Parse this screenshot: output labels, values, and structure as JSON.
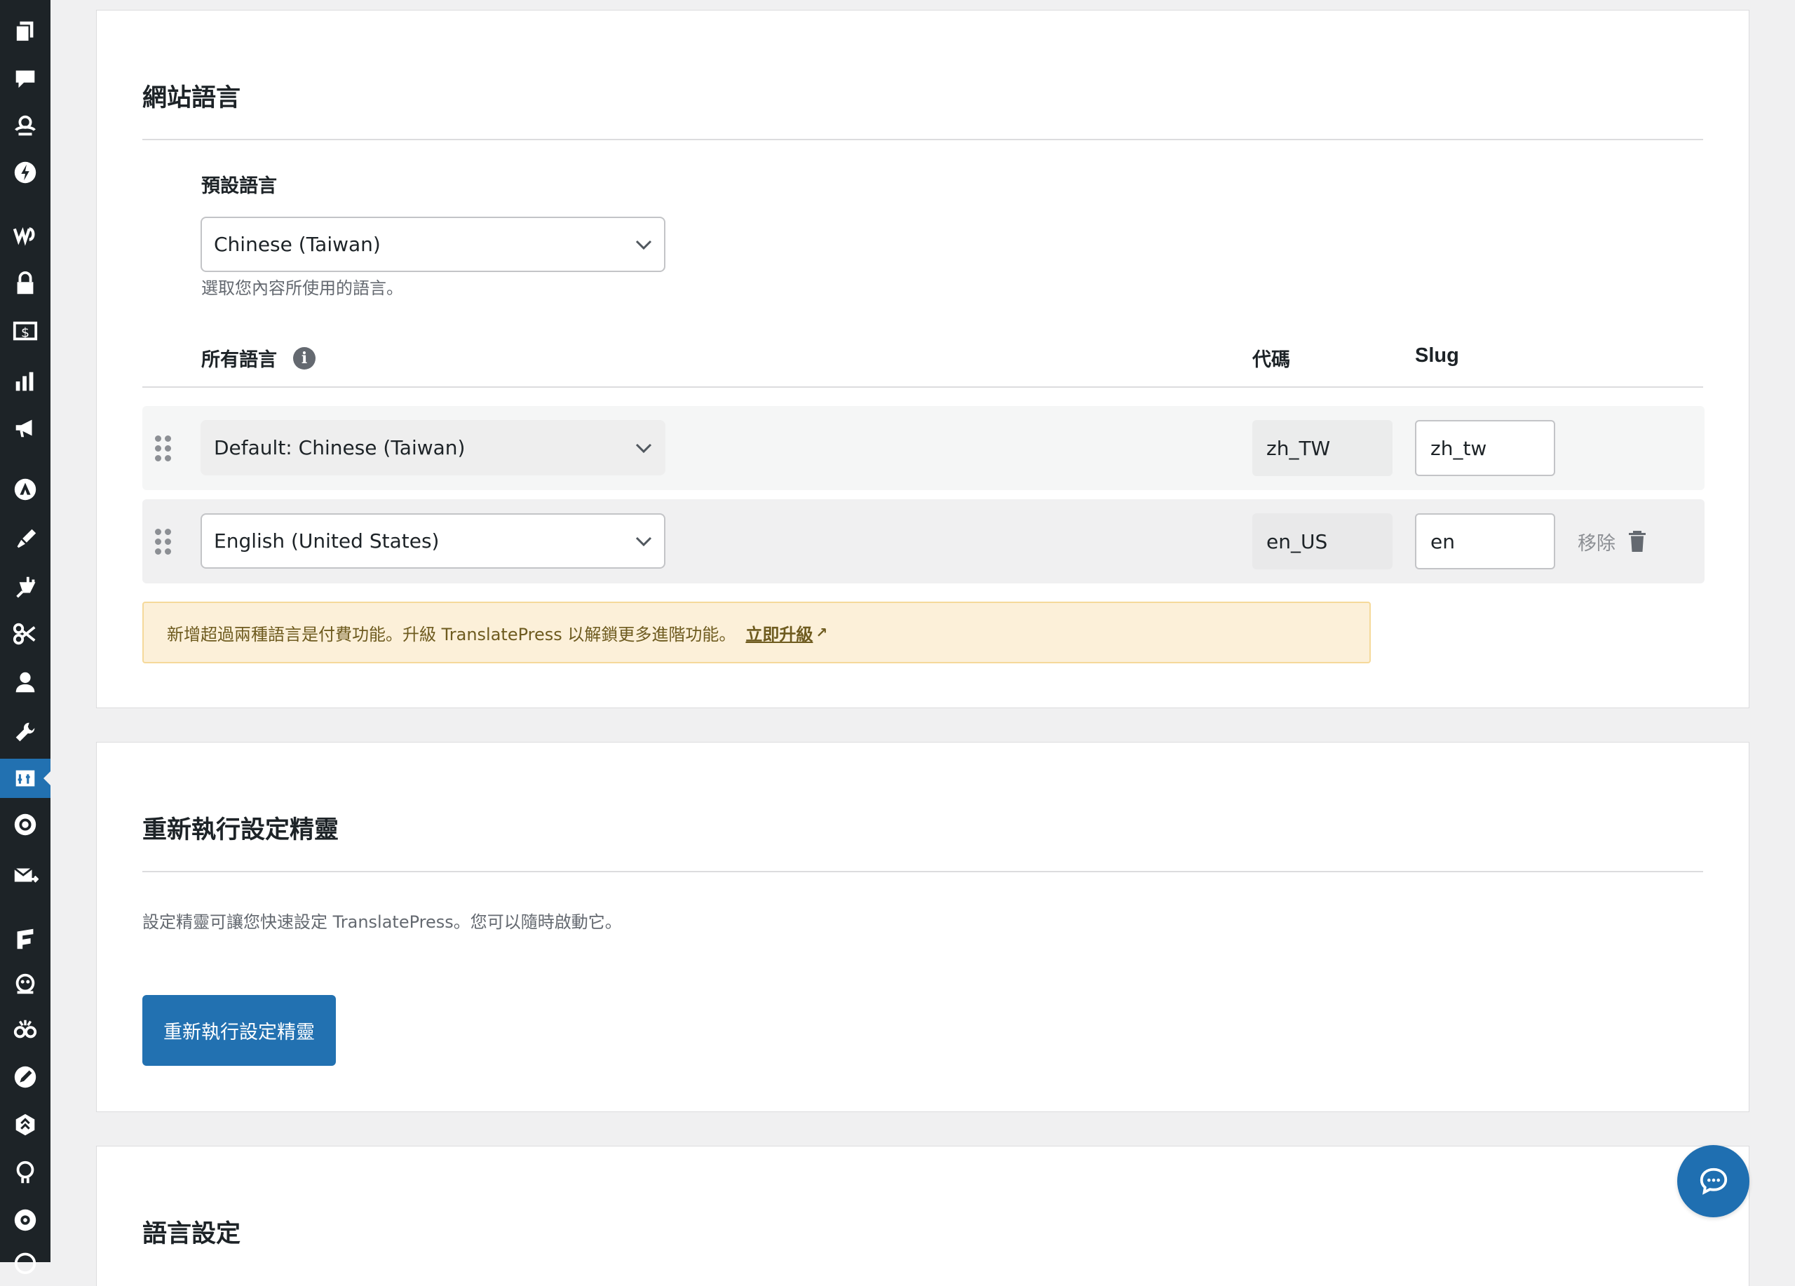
{
  "sidebar": {
    "icons": [
      "pages-icon",
      "comments-icon",
      "bug-icon",
      "bolt-icon",
      "woo-icon",
      "store-icon",
      "payments-icon",
      "analytics-icon",
      "marketing-icon",
      "astra-icon",
      "appearance-icon",
      "plugins-icon",
      "tools-scissors-icon",
      "users-icon",
      "settings-wrench-icon",
      "translatepress-icon",
      "gear-circle-icon",
      "mail-icon",
      "forms-icon",
      "bot-icon",
      "community-icon",
      "rocket-icon",
      "updraft-icon",
      "brain-icon",
      "eye-icon"
    ],
    "active": "translatepress-icon"
  },
  "website_language": {
    "title": "網站語言",
    "default_language_label": "預設語言",
    "default_language_value": "Chinese (Taiwan)",
    "default_language_desc": "選取您內容所使用的語言。",
    "all_languages_label": "所有語言",
    "info_glyph": "i",
    "code_header": "代碼",
    "slug_header": "Slug",
    "languages": [
      {
        "name": "Default: Chinese (Taiwan)",
        "code": "zh_TW",
        "slug": "zh_tw"
      },
      {
        "name": "English (United States)",
        "code": "en_US",
        "slug": "en",
        "remove_label": "移除"
      }
    ],
    "notice": {
      "text": "新增超過兩種語言是付費功能。升級 TranslatePress 以解鎖更多進階功能。",
      "link": "立即升級",
      "link_glyph": "↗"
    }
  },
  "wizard": {
    "title": "重新執行設定精靈",
    "desc": "設定精靈可讓您快速設定 TranslatePress。您可以隨時啟動它。",
    "button": "重新執行設定精靈"
  },
  "language_settings": {
    "title": "語言設定"
  },
  "colors": {
    "primary": "#2271b1",
    "sidebar": "#1d2327",
    "notice_bg": "#fcf0d9"
  }
}
